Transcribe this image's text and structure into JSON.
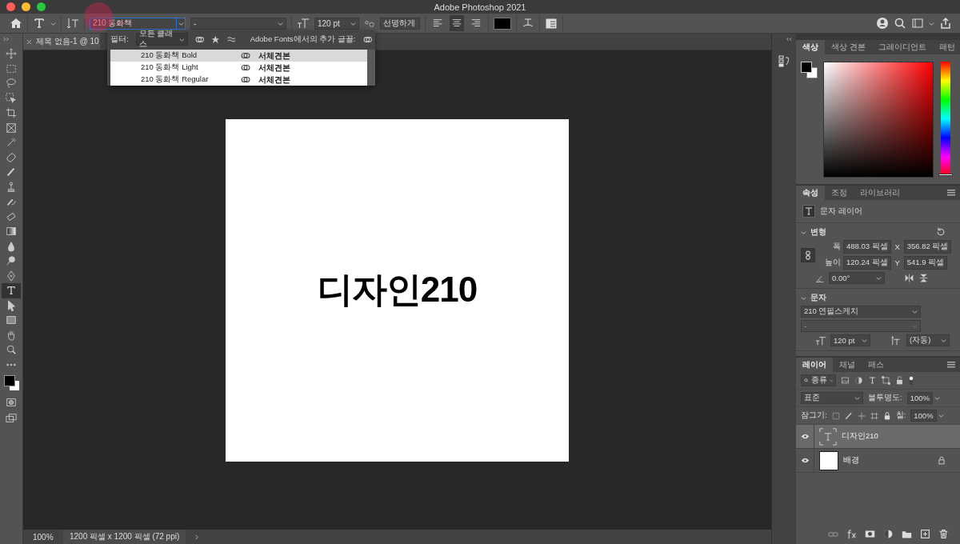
{
  "window": {
    "title": "Adobe Photoshop 2021"
  },
  "options_bar": {
    "font_family": "210 동화책",
    "font_style": "-",
    "font_size": "120 pt",
    "antialias": "선명하게",
    "align": [
      {
        "kind": "left",
        "selected": false
      },
      {
        "kind": "center",
        "selected": true
      },
      {
        "kind": "right",
        "selected": false
      }
    ]
  },
  "font_menu": {
    "filter_label": "필터:",
    "filter_value": "모든 클래스",
    "adobe_fonts_label": "Adobe Fonts에서의 추가 글꼴:",
    "items": [
      {
        "name": "210 동화책 Bold",
        "sample": "서체견본",
        "selected": true
      },
      {
        "name": "210 동화책 Light",
        "sample": "서체견본",
        "selected": false
      },
      {
        "name": "210 동화책 Regular",
        "sample": "서체견본",
        "selected": false
      }
    ]
  },
  "document": {
    "tab_title": "제목 없음-1 @ 10",
    "canvas_text": "디자인210",
    "zoom": "100%",
    "info": "1200 픽셀 x 1200 픽셀 (72 ppi)"
  },
  "tools": [
    {
      "kind": "move",
      "selected": false
    },
    {
      "kind": "marquee",
      "selected": false
    },
    {
      "kind": "lasso",
      "selected": false
    },
    {
      "kind": "object-select",
      "selected": false
    },
    {
      "kind": "crop",
      "selected": false
    },
    {
      "kind": "frame",
      "selected": false
    },
    {
      "kind": "eyedropper",
      "selected": false
    },
    {
      "kind": "healing",
      "selected": false
    },
    {
      "kind": "brush",
      "selected": false
    },
    {
      "kind": "stamp",
      "selected": false
    },
    {
      "kind": "history-brush",
      "selected": false
    },
    {
      "kind": "eraser",
      "selected": false
    },
    {
      "kind": "gradient",
      "selected": false
    },
    {
      "kind": "blur",
      "selected": false
    },
    {
      "kind": "dodge",
      "selected": false
    },
    {
      "kind": "pen",
      "selected": false
    },
    {
      "kind": "type",
      "selected": true
    },
    {
      "kind": "path-select",
      "selected": false
    },
    {
      "kind": "rectangle",
      "selected": false
    },
    {
      "kind": "hand",
      "selected": false
    },
    {
      "kind": "zoom",
      "selected": false
    },
    {
      "kind": "more",
      "selected": false
    }
  ],
  "color_panel": {
    "hue_slider": {
      "level": 0
    },
    "tabs": [
      {
        "label": "색상",
        "selected": true
      },
      {
        "label": "색상 견본",
        "selected": false
      },
      {
        "label": "그레이디언트",
        "selected": false
      },
      {
        "label": "패턴",
        "selected": false
      }
    ]
  },
  "properties": {
    "tabs": [
      {
        "label": "속성",
        "selected": true
      },
      {
        "label": "조정",
        "selected": false
      },
      {
        "label": "라이브러리",
        "selected": false
      }
    ],
    "layer_kind": "문자 레이어",
    "transform": {
      "title": "변형",
      "w_label": "폭",
      "w": "488.03 픽셀",
      "x_label": "X",
      "x": "356.82 픽셀",
      "h_label": "높이",
      "h": "120.24 픽셀",
      "y_label": "Y",
      "y": "541.9 픽셀",
      "angle": "0.00°"
    },
    "character": {
      "title": "문자",
      "font": "210 연필스케치",
      "style": "-",
      "size": "120 pt",
      "leading": "(자동)"
    }
  },
  "layers_panel": {
    "tabs": [
      {
        "label": "레이어",
        "selected": true
      },
      {
        "label": "채널",
        "selected": false
      },
      {
        "label": "패스",
        "selected": false
      }
    ],
    "filter": "종류",
    "blend": "표준",
    "opacity_label": "불투명도:",
    "opacity": "100%",
    "lock_label": "잠그기:",
    "fill_label": "칠:",
    "fill": "100%",
    "layers": [
      {
        "kind": "text",
        "name": "디자인210",
        "visible": true,
        "selected": true,
        "locked": false
      },
      {
        "kind": "image",
        "name": "배경",
        "visible": true,
        "selected": false,
        "locked": true
      }
    ]
  }
}
